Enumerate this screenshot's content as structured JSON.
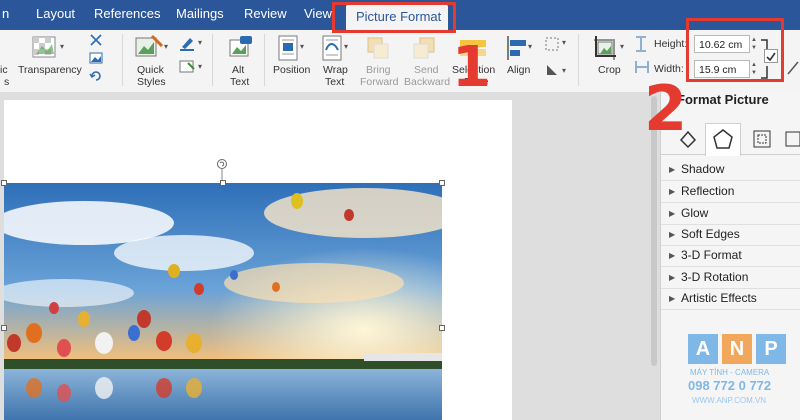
{
  "tabs": {
    "partial_left": "n",
    "items": [
      "Layout",
      "References",
      "Mailings",
      "Review",
      "View"
    ],
    "active": "Picture Format"
  },
  "ribbon": {
    "partial_left_1": "ic",
    "partial_left_2": "s",
    "transparency": "Transparency",
    "quick_styles_1": "Quick",
    "quick_styles_2": "Styles",
    "alt_text_1": "Alt",
    "alt_text_2": "Text",
    "position": "Position",
    "wrap_text_1": "Wrap",
    "wrap_text_2": "Text",
    "bring_forward_1": "Bring",
    "bring_forward_2": "Forward",
    "send_backward_1": "Send",
    "send_backward_2": "Backward",
    "selection_pane_1": "Selection",
    "selection_pane_2": "Pane",
    "align": "Align",
    "crop": "Crop",
    "height_label": "Height:",
    "height_value": "10.62 cm",
    "width_label": "Width:",
    "width_value": "15.9 cm"
  },
  "pane": {
    "title": "Format Picture",
    "sections": [
      "Shadow",
      "Reflection",
      "Glow",
      "Soft Edges",
      "3-D Format",
      "3-D Rotation",
      "Artistic Effects"
    ]
  },
  "annotations": {
    "step1": "1",
    "step2": "2"
  },
  "watermark": {
    "letters": [
      "A",
      "N",
      "P"
    ],
    "tagline": "MÁY TÍNH - CAMERA",
    "phone": "098 772 0 772",
    "site": "WWW.ANP.COM.VN"
  },
  "colors": {
    "ribbon_blue": "#2b579a",
    "annotation_red": "#e53a2f",
    "watermark_blue": "#2a7fc1"
  }
}
